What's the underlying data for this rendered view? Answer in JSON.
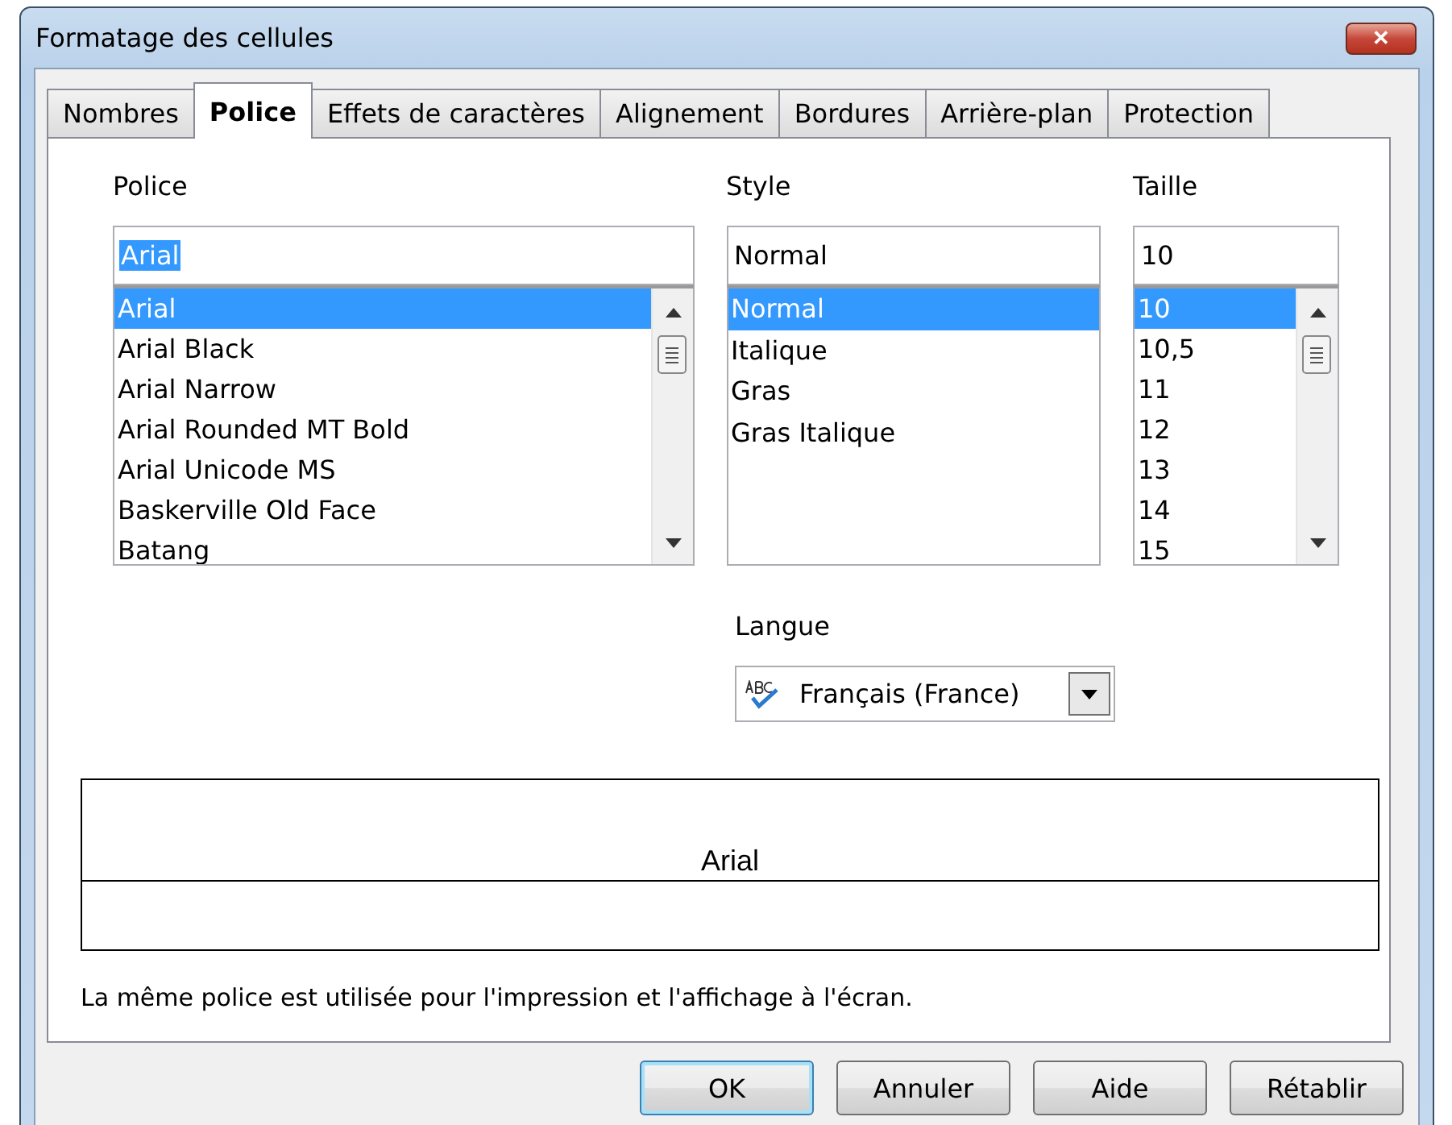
{
  "window": {
    "title": "Formatage des cellules",
    "close": "✕"
  },
  "tabs": [
    {
      "label": "Nombres",
      "selected": false
    },
    {
      "label": "Police",
      "selected": true
    },
    {
      "label": "Effets de caractères",
      "selected": false
    },
    {
      "label": "Alignement",
      "selected": false
    },
    {
      "label": "Bordures",
      "selected": false
    },
    {
      "label": "Arrière-plan",
      "selected": false
    },
    {
      "label": "Protection",
      "selected": false
    }
  ],
  "font": {
    "label": "Police",
    "value": "Arial",
    "value_selected": true,
    "scrollbar": true,
    "items": [
      {
        "label": "Arial",
        "selected": true
      },
      {
        "label": "Arial Black",
        "selected": false
      },
      {
        "label": "Arial Narrow",
        "selected": false
      },
      {
        "label": "Arial Rounded MT Bold",
        "selected": false
      },
      {
        "label": "Arial Unicode MS",
        "selected": false
      },
      {
        "label": "Baskerville Old Face",
        "selected": false
      },
      {
        "label": "Batang",
        "selected": false
      }
    ]
  },
  "style": {
    "label": "Style",
    "value": "Normal",
    "value_selected": false,
    "scrollbar": false,
    "items": [
      {
        "label": "Normal",
        "selected": true
      },
      {
        "label": "Italique",
        "selected": false
      },
      {
        "label": "Gras",
        "selected": false
      },
      {
        "label": "Gras Italique",
        "selected": false
      }
    ]
  },
  "size": {
    "label": "Taille",
    "value": "10",
    "value_selected": false,
    "scrollbar": true,
    "items": [
      {
        "label": "10",
        "selected": true
      },
      {
        "label": "10,5",
        "selected": false
      },
      {
        "label": "11",
        "selected": false
      },
      {
        "label": "12",
        "selected": false
      },
      {
        "label": "13",
        "selected": false
      },
      {
        "label": "14",
        "selected": false
      },
      {
        "label": "15",
        "selected": false
      }
    ]
  },
  "language": {
    "label": "Langue",
    "value": "Français (France)"
  },
  "preview": {
    "text": "Arial"
  },
  "info": "La même police est utilisée pour l'impression et l'affichage à l'écran.",
  "buttons": [
    {
      "label": "OK",
      "default": true
    },
    {
      "label": "Annuler",
      "default": false
    },
    {
      "label": "Aide",
      "default": false
    },
    {
      "label": "Rétablir",
      "default": false
    }
  ]
}
